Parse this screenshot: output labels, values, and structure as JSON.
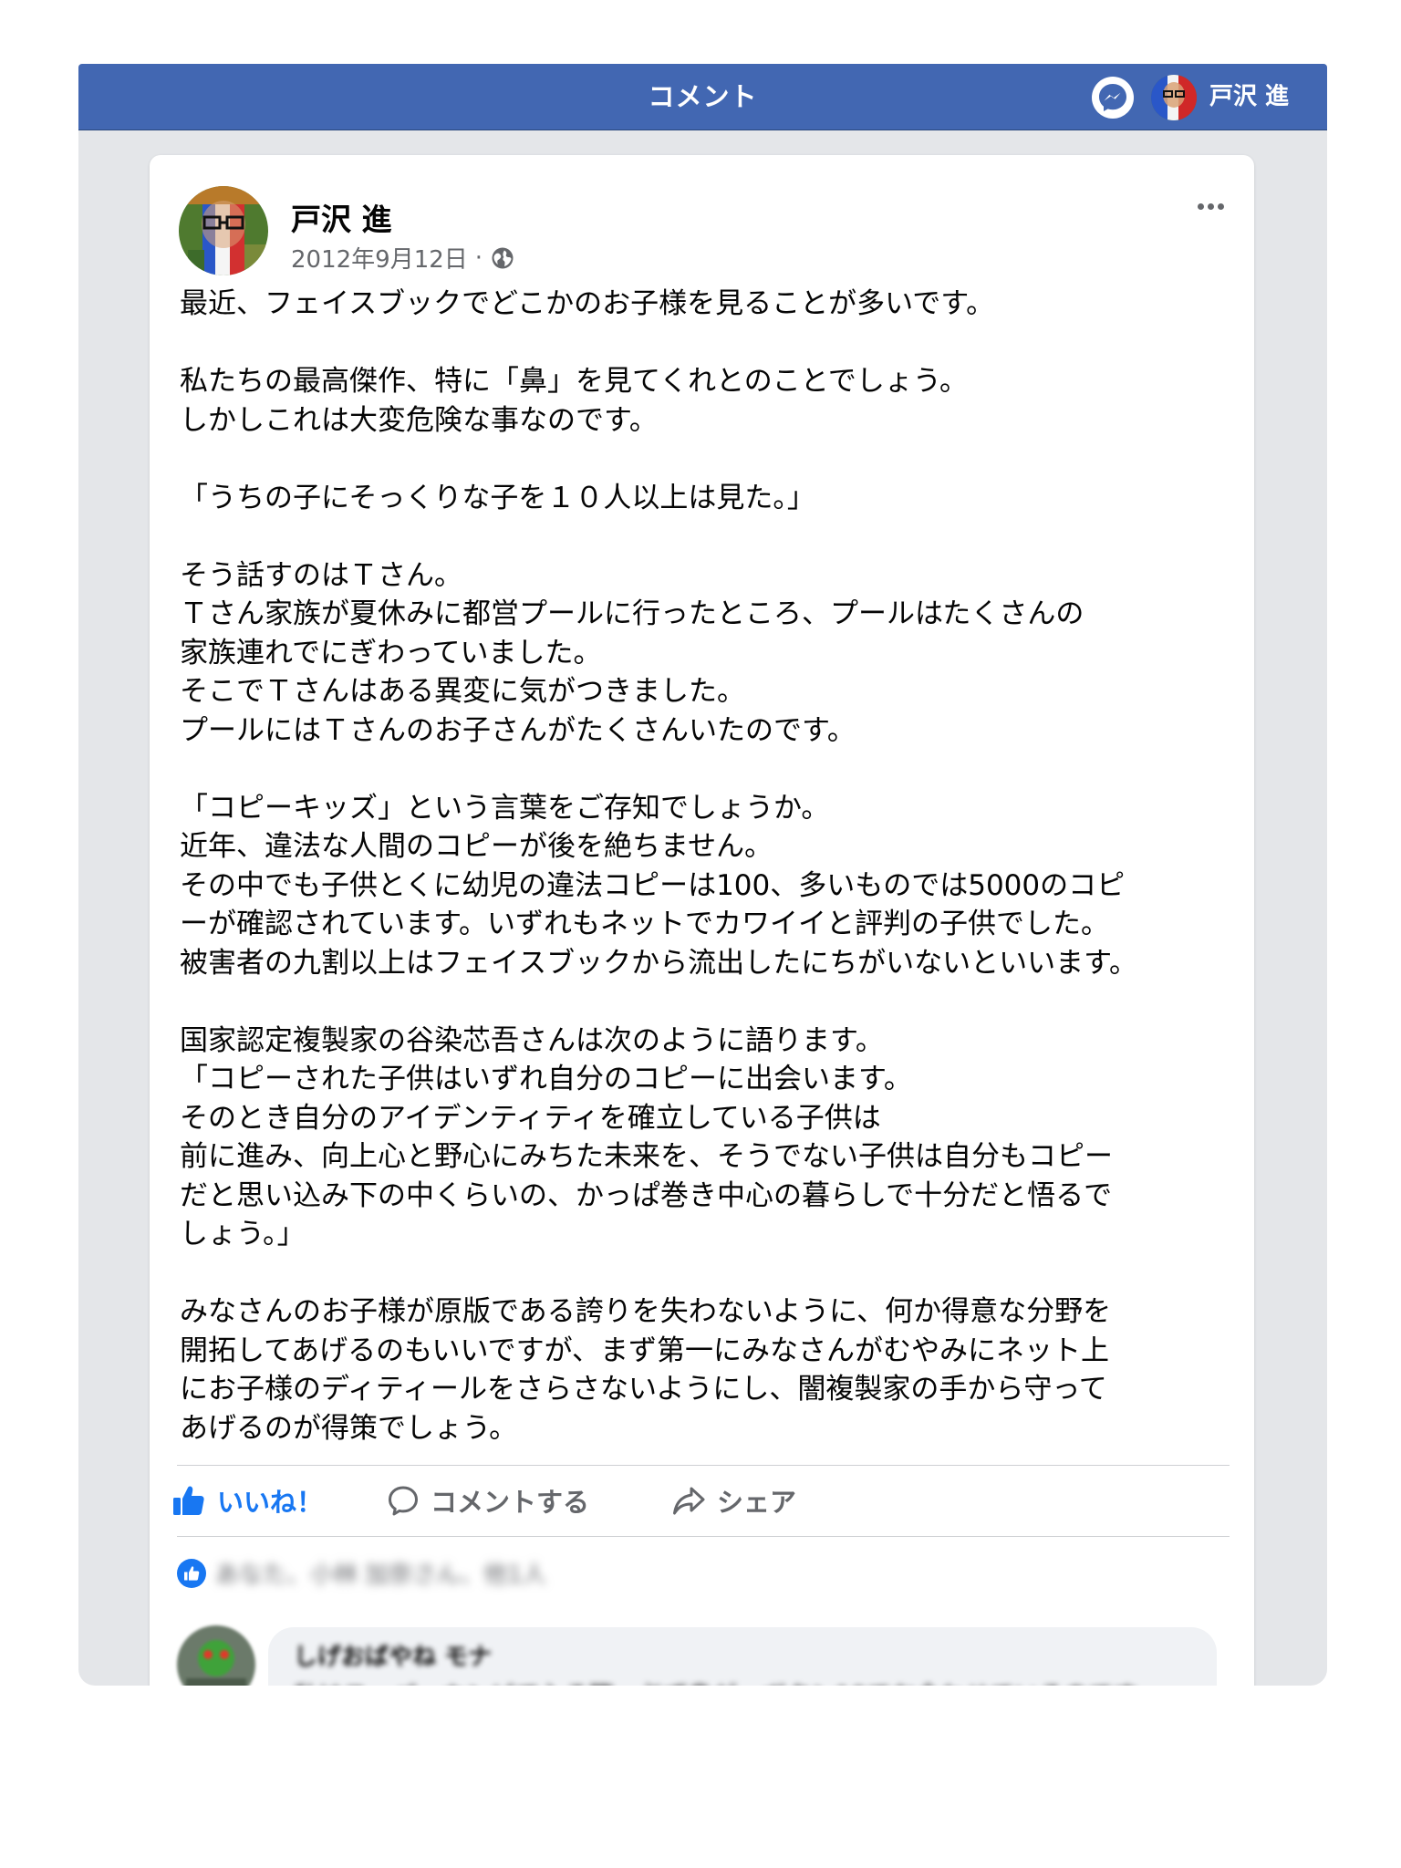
{
  "topbar": {
    "title": "コメント",
    "user_name": "戸沢 進",
    "messenger_icon": "messenger-icon",
    "brand_color": "#4267b2"
  },
  "post": {
    "author": "戸沢 進",
    "date": "2012年9月12日",
    "date_separator": "·",
    "privacy_icon": "globe-icon",
    "lines": [
      "最近、フェイスブックでどこかのお子様を見ることが多いです。",
      "",
      "私たちの最高傑作、特に「鼻」を見てくれとのことでしょう。",
      "しかしこれは大変危険な事なのです。",
      "",
      "「うちの子にそっくりな子を１０人以上は見た。」",
      "",
      "そう話すのはＴさん。",
      "Ｔさん家族が夏休みに都営プールに行ったところ、プールはたくさんの",
      "家族連れでにぎわっていました。",
      "そこでＴさんはある異変に気がつきました。",
      "プールにはＴさんのお子さんがたくさんいたのです。",
      "",
      "「コピーキッズ」という言葉をご存知でしょうか。",
      "近年、違法な人間のコピーが後を絶ちません。",
      "その中でも子供とくに幼児の違法コピーは100、多いものでは5000のコピ",
      "ーが確認されています。いずれもネットでカワイイと評判の子供でした。",
      "被害者の九割以上はフェイスブックから流出したにちがいないといいます。",
      "",
      "国家認定複製家の谷染芯吾さんは次のように語ります。",
      "「コピーされた子供はいずれ自分のコピーに出会います。",
      "そのとき自分のアイデンティティを確立している子供は",
      "前に進み、向上心と野心にみちた未来を、そうでない子供は自分もコピー",
      "だと思い込み下の中くらいの、かっぱ巻き中心の暮らしで十分だと悟るで",
      "しょう。」",
      "",
      "みなさんのお子様が原版である誇りを失わないように、何か得意な分野を",
      "開拓してあげるのもいいですが、まず第一にみなさんがむやみにネット上",
      "にお子様のディティールをさらさないようにし、闇複製家の手から守って",
      "あげるのが得策でしょう。"
    ]
  },
  "actions": {
    "like": "いいね！",
    "comment": "コメントする",
    "share": "シェア"
  },
  "reactions": {
    "summary": "あなた、小林 加奈さん、他1人"
  },
  "comment": {
    "name": "しげおばやね モナ",
    "text": "私はスーパーカンピで入る際、必ず鼻が一ボタン10でお全わせているのです"
  },
  "colors": {
    "like_blue": "#1877f2",
    "muted_text": "#65676b"
  }
}
